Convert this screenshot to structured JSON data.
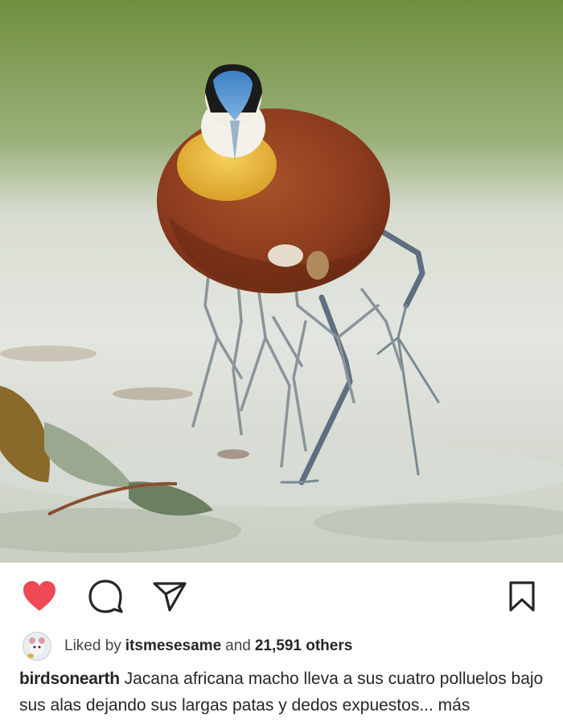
{
  "post": {
    "image_alt": "Jacana africana con polluelos bajo sus alas",
    "actions": {
      "like_icon": "heart-filled-icon",
      "comment_icon": "comment-bubble-icon",
      "share_icon": "paper-plane-icon",
      "save_icon": "bookmark-icon",
      "like_color": "#ed4956"
    },
    "likes": {
      "prefix": "Liked by",
      "user": "itsmesesame",
      "connector": "and",
      "count": "21,591 others"
    },
    "caption": {
      "username": "birdsonearth",
      "text": "Jacana africana macho lleva a sus cuatro polluelos bajo sus alas dejando sus largas patas y dedos expuestos...",
      "more": "más"
    }
  }
}
